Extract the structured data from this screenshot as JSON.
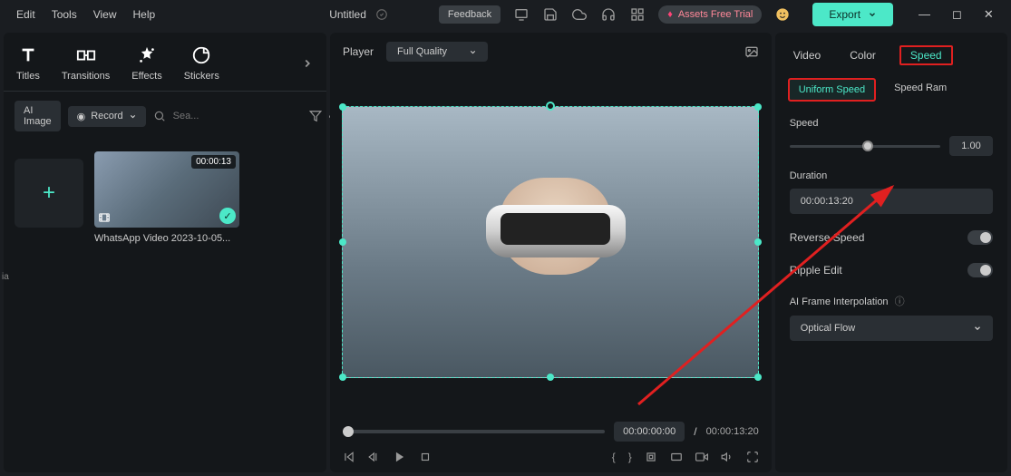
{
  "menu": {
    "edit": "Edit",
    "tools": "Tools",
    "view": "View",
    "help": "Help"
  },
  "doc": {
    "title": "Untitled"
  },
  "topbar": {
    "feedback": "Feedback",
    "assets": "Assets Free Trial",
    "export": "Export"
  },
  "tooltabs": {
    "titles": "Titles",
    "transitions": "Transitions",
    "effects": "Effects",
    "stickers": "Stickers"
  },
  "toolbar": {
    "ai_image": "AI Image",
    "record": "Record",
    "search_placeholder": "Sea..."
  },
  "media": {
    "sidelabel": "ia",
    "clip_duration": "00:00:13",
    "clip_name": "WhatsApp Video 2023-10-05..."
  },
  "preview": {
    "player_label": "Player",
    "quality": "Full Quality",
    "current_time": "00:00:00:00",
    "sep": "/",
    "total_time": "00:00:13:20"
  },
  "right": {
    "tabs": {
      "video": "Video",
      "color": "Color",
      "speed": "Speed"
    },
    "subtabs": {
      "uniform": "Uniform Speed",
      "ramp": "Speed Ram"
    },
    "speed_label": "Speed",
    "speed_value": "1.00",
    "duration_label": "Duration",
    "duration_value": "00:00:13:20",
    "reverse_label": "Reverse Speed",
    "ripple_label": "Ripple Edit",
    "ai_frame_label": "AI Frame Interpolation",
    "ai_frame_value": "Optical Flow"
  }
}
